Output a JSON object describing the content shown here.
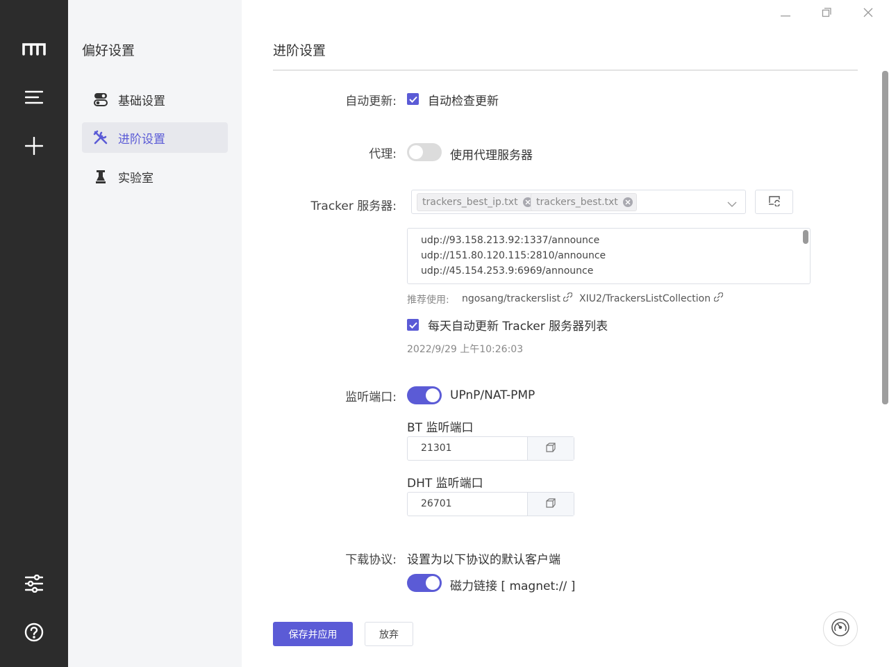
{
  "window": {
    "controls": [
      "minimize-icon",
      "maximize-icon",
      "close-icon"
    ]
  },
  "rail": {
    "top_icons": [
      "logo-icon",
      "menu-icon",
      "plus-icon"
    ],
    "bottom_icons": [
      "sliders-icon",
      "help-icon"
    ]
  },
  "preferences": {
    "title": "偏好设置",
    "items": [
      {
        "label": "基础设置",
        "icon": "toggle-icon",
        "active": false
      },
      {
        "label": "进阶设置",
        "icon": "tools-icon",
        "active": true
      },
      {
        "label": "实验室",
        "icon": "flask-icon",
        "active": false
      }
    ]
  },
  "main": {
    "title": "进阶设置",
    "auto_update": {
      "label": "自动更新:",
      "checkbox_label": "自动检查更新",
      "checked": true
    },
    "proxy": {
      "label": "代理:",
      "switch_label": "使用代理服务器",
      "enabled": false
    },
    "tracker": {
      "label": "Tracker 服务器:",
      "tags": [
        "trackers_best_ip.txt",
        "trackers_best.txt"
      ],
      "lines": [
        "udp://93.158.213.92:1337/announce",
        "udp://151.80.120.115:2810/announce",
        "udp://45.154.253.9:6969/announce"
      ],
      "recommend_label": "推荐使用:",
      "links": [
        "ngosang/trackerslist",
        "XIU2/TrackersListCollection"
      ],
      "auto_sync_label": "每天自动更新 Tracker 服务器列表",
      "auto_sync_checked": true,
      "last_sync": "2022/9/29 上午10:26:03"
    },
    "port": {
      "label": "监听端口:",
      "upnp_label": "UPnP/NAT-PMP",
      "upnp_enabled": true,
      "bt_label": "BT 监听端口",
      "bt_value": "21301",
      "dht_label": "DHT 监听端口",
      "dht_value": "26701"
    },
    "protocol": {
      "label": "下载协议:",
      "description": "设置为以下协议的默认客户端",
      "magnet_label": "磁力链接 [ magnet:// ]",
      "magnet_enabled": true
    },
    "actions": {
      "save": "保存并应用",
      "discard": "放弃"
    }
  },
  "colors": {
    "accent": "#5b5bd6",
    "rail": "#2c2c2c",
    "sidebar": "#f4f5f7"
  }
}
